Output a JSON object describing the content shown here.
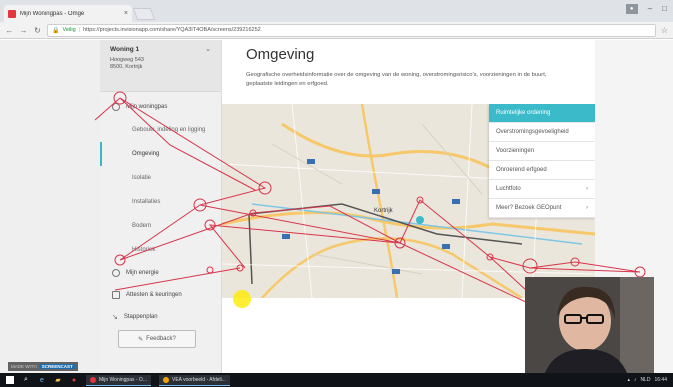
{
  "browser": {
    "tab_title": "Mijn Woningpas - Omge",
    "tab_close": "×",
    "url_secure_label": "Veilig",
    "url": "https://projects.invisionapp.com/share/YQA3IT4OBA/screens/239216252",
    "window_controls": [
      "–",
      "□"
    ]
  },
  "sidebar": {
    "home_title": "Woning 1",
    "home_address_line1": "Hoogweg 543",
    "home_address_line2": "8500, Kortrijk",
    "sections": {
      "woningpas": "Mijn woningpas",
      "energie": "Mijn energie",
      "attesten": "Attesten & keuringen",
      "stappenplan": "Stappenplan"
    },
    "woningpas_items": [
      "Gebouw, indeling en ligging",
      "Omgeving",
      "Isolatie",
      "Installaties",
      "Bodem",
      "Historiek"
    ],
    "active_item": "Omgeving",
    "feedback_label": "Feedback?"
  },
  "main": {
    "title": "Omgeving",
    "description": "Geografische overheidsinformatie over de omgeving van de woning, overstromingsrisico's, voorzieningen in de buurt, geplaatste leidingen en erfgoed."
  },
  "map": {
    "layers": [
      {
        "label": "Ruimtelijke ordening",
        "active": true,
        "chevron": false
      },
      {
        "label": "Overstromingsgevoeligheid",
        "active": false,
        "chevron": false
      },
      {
        "label": "Voorzieningen",
        "active": false,
        "chevron": false
      },
      {
        "label": "Onroerend erfgoed",
        "active": false,
        "chevron": false
      },
      {
        "label": "Luchtfoto",
        "active": false,
        "chevron": true
      },
      {
        "label": "Meer? Bezoek GEOpunt",
        "active": false,
        "chevron": true
      }
    ],
    "city_label": "Kortrijk"
  },
  "recording": {
    "watermark_text": "MADE WITH",
    "watermark_brand": "SCREENCAST"
  },
  "taskbar": {
    "apps": [
      {
        "label": "Mijn Woningpas - O...",
        "color": "#e2373f"
      },
      {
        "label": "VEA voorbeeld - Afdeli...",
        "color": "#f1a400"
      }
    ],
    "tray_language": "NLD",
    "tray_time": "16:44"
  },
  "colors": {
    "accent": "#3bbbc9",
    "annotation_red": "#d8344a"
  }
}
